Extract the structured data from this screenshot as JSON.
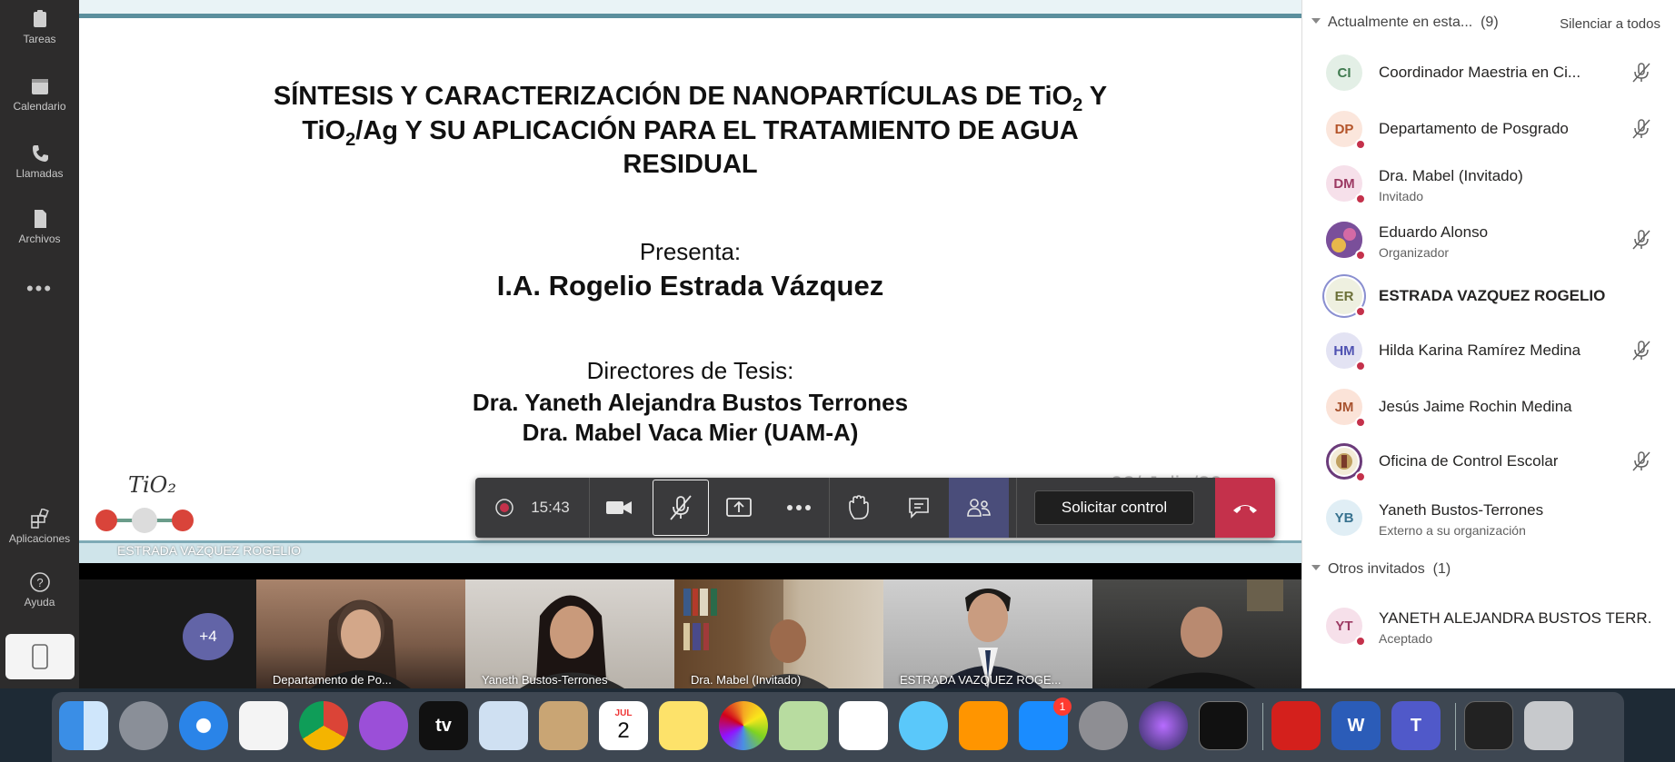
{
  "rail": {
    "items": [
      {
        "label": "Tareas",
        "icon": "tasks-icon"
      },
      {
        "label": "Calendario",
        "icon": "calendar-icon"
      },
      {
        "label": "Llamadas",
        "icon": "phone-icon"
      },
      {
        "label": "Archivos",
        "icon": "files-icon"
      },
      {
        "label": "•••",
        "icon": "more-icon"
      },
      {
        "label": "Aplicaciones",
        "icon": "apps-icon"
      },
      {
        "label": "Ayuda",
        "icon": "help-icon"
      }
    ]
  },
  "slide": {
    "title_line1": "SÍNTESIS Y CARACTERIZACIÓN DE NANOPARTÍCULAS DE TiO",
    "title_line1_sub": "2",
    "title_line1_end": " Y",
    "title_line2_a": "TiO",
    "title_line2_sub": "2",
    "title_line2_b": "/Ag Y SU APLICACIÓN PARA EL TRATAMIENTO DE AGUA",
    "title_line3": "RESIDUAL",
    "presenta": "Presenta:",
    "presenter": "I.A. Rogelio Estrada Vázquez",
    "directores": "Directores de Tesis:",
    "director1": "Dra. Yaneth Alejandra Bustos Terrones",
    "director2": "Dra. Mabel Vaca Mier (UAM-A)",
    "date": "02/ Julio/20",
    "logo_text": "TiO₂",
    "footer": "ESTRADA VAZQUEZ ROGELIO"
  },
  "toolbar": {
    "timer": "15:43",
    "request_control": "Solicitar control"
  },
  "strip": {
    "more": "+4",
    "tiles": [
      {
        "name": "Departamento de Po..."
      },
      {
        "name": "Yaneth Bustos-Terrones"
      },
      {
        "name": "Dra. Mabel (Invitado)"
      },
      {
        "name": "ESTRADA VAZQUEZ ROGE..."
      },
      {
        "name": ""
      }
    ]
  },
  "roster": {
    "section_current": "Actualmente en esta...",
    "section_current_count": "(9)",
    "mute_all": "Silenciar a todos",
    "people": [
      {
        "initials": "CI",
        "name": "Coordinador Maestria en Ci...",
        "sub": "",
        "muted": true,
        "bg": "#e3efe6",
        "fg": "#3f7a4f"
      },
      {
        "initials": "DP",
        "name": "Departamento de Posgrado",
        "sub": "",
        "muted": true,
        "bg": "#fbe6dc",
        "fg": "#b4542a"
      },
      {
        "initials": "DM",
        "name": "Dra. Mabel (Invitado)",
        "sub": "Invitado",
        "muted": false,
        "bg": "#f6e0ea",
        "fg": "#9c3a63"
      },
      {
        "initials": "",
        "name": "Eduardo Alonso",
        "sub": "Organizador",
        "muted": true,
        "bg": "#8a5aa5",
        "fg": "#fff"
      },
      {
        "initials": "ER",
        "name": "ESTRADA VAZQUEZ ROGELIO",
        "sub": "",
        "muted": false,
        "bg": "#eef0e0",
        "fg": "#6b7038"
      },
      {
        "initials": "HM",
        "name": "Hilda Karina Ramírez Medina",
        "sub": "",
        "muted": true,
        "bg": "#e3e3f3",
        "fg": "#4f52b2"
      },
      {
        "initials": "JM",
        "name": "Jesús Jaime Rochin Medina",
        "sub": "",
        "muted": false,
        "bg": "#fbe3d8",
        "fg": "#a8532f"
      },
      {
        "initials": "",
        "name": "Oficina de Control Escolar",
        "sub": "",
        "muted": true,
        "bg": "#ffffff",
        "fg": "#6b3b7a"
      },
      {
        "initials": "YB",
        "name": "Yaneth Bustos-Terrones",
        "sub": "Externo a su organización",
        "muted": false,
        "bg": "#e0eef5",
        "fg": "#37728f"
      }
    ],
    "section_other": "Otros invitados",
    "section_other_count": "(1)",
    "other": {
      "initials": "YT",
      "name": "YANETH ALEJANDRA BUSTOS TERR...",
      "sub": "Aceptado",
      "bg": "#f6e0ea",
      "fg": "#9c3a63"
    }
  },
  "dock": {
    "apps": [
      "finder-icon",
      "launchpad-icon",
      "safari-icon",
      "music-icon",
      "chrome-icon",
      "podcasts-icon",
      "tv-icon",
      "mail-icon",
      "contacts-icon",
      "calendar-app-icon",
      "notes-icon",
      "photos-icon",
      "maps-icon",
      "reminders-icon",
      "messages-icon",
      "books-icon",
      "appstore-icon",
      "system-preferences-icon",
      "siri-icon",
      "terminal-icon",
      "acrobat-icon",
      "word-icon",
      "teams-icon",
      "screenshot-icon",
      "trash-icon"
    ],
    "calendar_month": "JUL",
    "calendar_day": "2",
    "tv_label": "tv",
    "appstore_badge": "1",
    "word_letter": "W",
    "teams_letter": "T"
  }
}
